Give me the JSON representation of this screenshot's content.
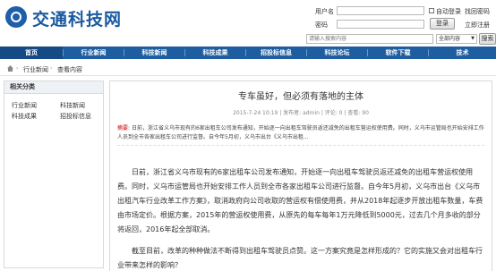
{
  "header": {
    "site_title": "交通科技网",
    "login": {
      "username_label": "用户名",
      "password_label": "密码",
      "auto_login": "自动登录",
      "forgot_password": "找回密码",
      "login_button": "登录",
      "register_link": "立即注册"
    },
    "search": {
      "placeholder": "请输入搜索内容",
      "scope": "全部内容",
      "button": "搜索"
    }
  },
  "nav": {
    "items": [
      "首页",
      "行业新闻",
      "科技新闻",
      "科技成果",
      "招投标信息",
      "科技论坛",
      "软件下载",
      "技术"
    ]
  },
  "breadcrumb": {
    "items": [
      "行业新闻",
      "查看内容"
    ]
  },
  "sidebar": {
    "heading": "相关分类",
    "links": [
      "行业新闻",
      "科技新闻",
      "科技成果",
      "招投标信息"
    ]
  },
  "article": {
    "title": "专车虽好，但必须有落地的主体",
    "meta": "2015-7-24 10:19 | 发布者: admin | 评论: 0 | 查看: 90",
    "summary_label": "摘要:",
    "summary_text": "日前，浙江省义乌市现有的6家出租车公司发布通知，开始逐一向出租车驾驶员返还减免的出租车营运权使用费。同时，义乌市运管局也开始安排工作人员到全市各家出租车公司进行监督。自今年5月初，义乌市出台《义乌市出租",
    "summary_more": "...",
    "para1": "日前，浙江省义乌市现有的6家出租车公司发布通知，开始逐一向出租车驾驶员返还减免的出租车营运权使用费。同时，义乌市运管局也开始安排工作人员到全市各家出租车公司进行监督。自今年5月初，义乌市出台《义乌市出租汽车行业改革工作方案》，取消政府向公司收取的营运权有偿使用费，并从2018年起逐步开放出租车数量，车费由市场定价。根据方案，2015年的营运权使用费，从原先的每车每年1万元降低到5000元，过去几个月多收的部分将返回，2016年起全部取消。",
    "para2": "截至目前，改革的种种做法不断得到出租车驾驶员点赞。这一方案究竟是怎样形成的？它的实施又会对出租车行业带来怎样的影响？"
  }
}
